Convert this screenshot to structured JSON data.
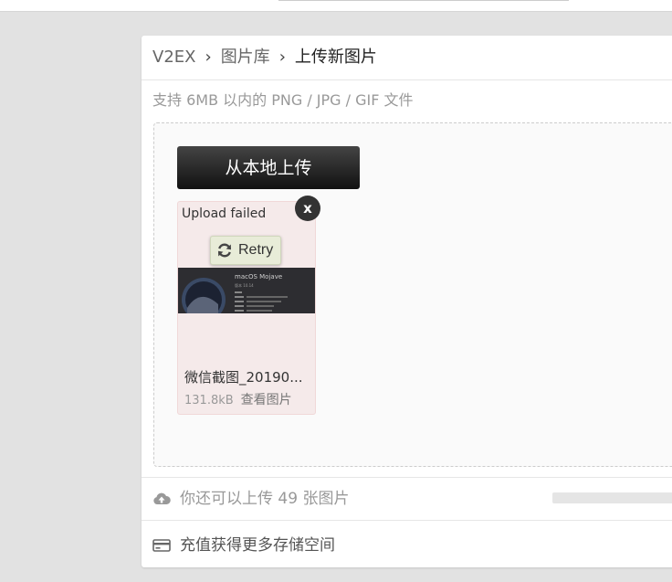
{
  "breadcrumb": {
    "home": "V2EX",
    "section": "图片库",
    "current": "上传新图片",
    "separator": "›"
  },
  "upload": {
    "hint": "支持 6MB 以内的 PNG / JPG / GIF 文件",
    "button_label": "从本地上传"
  },
  "file": {
    "status": "Upload failed",
    "close_label": "x",
    "retry_label": "Retry",
    "name": "微信截图_20190...",
    "size": "131.8kB",
    "view_label": "查看图片",
    "thumbnail": {
      "title": "macOS Mojave",
      "subtitle": "版本 10.14"
    }
  },
  "quota": {
    "text": "你还可以上传 49 张图片",
    "icon": "cloud-upload-icon",
    "remaining": 49
  },
  "recharge": {
    "text": "充值获得更多存储空间",
    "icon": "credit-card-icon"
  },
  "colors": {
    "button_dark": "#222222",
    "failed_card_bg": "#f5eaea",
    "retry_bg": "#e8ecd8"
  }
}
